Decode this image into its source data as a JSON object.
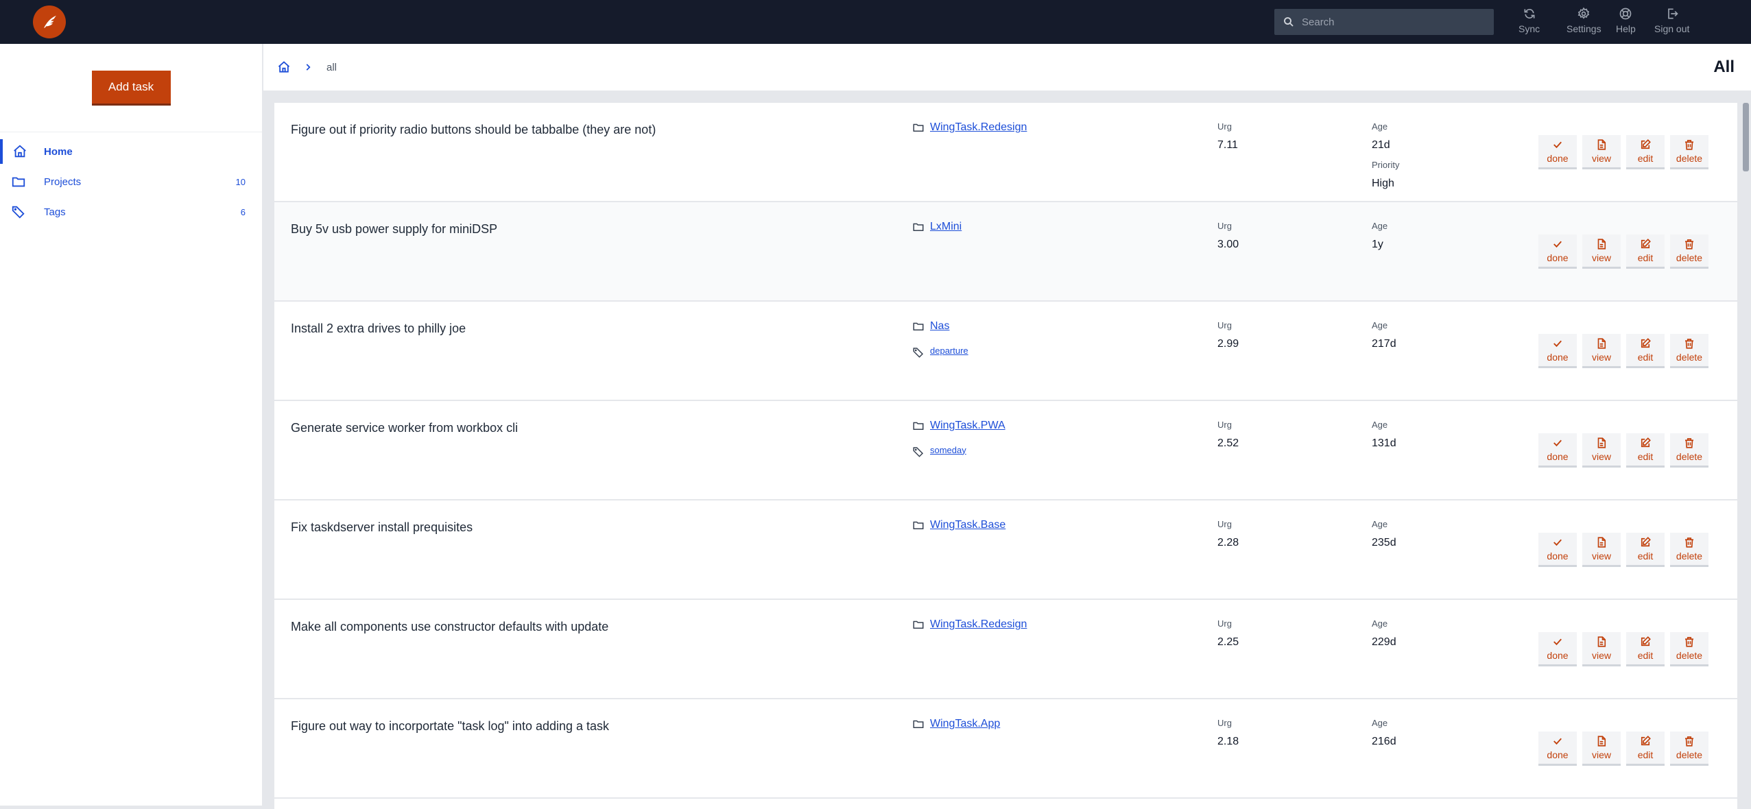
{
  "app": {
    "logo": "wing-logo",
    "accent": "#c2410c",
    "link_color": "#1d4ed8",
    "header_bg": "#151b2b"
  },
  "header": {
    "search_placeholder": "Search",
    "search_value": "",
    "nav": [
      {
        "label": "Sync",
        "icon": "sync-icon"
      },
      {
        "label": "Settings",
        "icon": "gear-icon"
      },
      {
        "label": "Help",
        "icon": "lifebuoy-icon"
      },
      {
        "label": "Sign out",
        "icon": "sign-out-icon"
      }
    ]
  },
  "sidebar": {
    "add_task_label": "Add task",
    "items": [
      {
        "label": "Home",
        "icon": "home-icon",
        "count": "",
        "active": true
      },
      {
        "label": "Projects",
        "icon": "folder-icon",
        "count": "10"
      },
      {
        "label": "Tags",
        "icon": "tag-icon",
        "count": "6"
      }
    ]
  },
  "breadcrumb": {
    "current": "all",
    "page_title": "All"
  },
  "labels": {
    "urg": "Urg",
    "age": "Age",
    "priority": "Priority",
    "done": "done",
    "view": "view",
    "edit": "edit",
    "delete": "delete"
  },
  "tasks": [
    {
      "description": "Figure out if priority radio buttons should be tabbalbe (they are not)",
      "project": "WingTask.Redesign",
      "tag": "",
      "urg": "7.11",
      "age": "21d",
      "priority": "High"
    },
    {
      "description": "Buy 5v usb power supply for miniDSP",
      "project": "LxMini",
      "tag": "",
      "urg": "3.00",
      "age": "1y",
      "priority": ""
    },
    {
      "description": "Install 2 extra drives to philly joe",
      "project": "Nas",
      "tag": "departure",
      "urg": "2.99",
      "age": "217d",
      "priority": ""
    },
    {
      "description": "Generate service worker from workbox cli",
      "project": "WingTask.PWA",
      "tag": "someday",
      "urg": "2.52",
      "age": "131d",
      "priority": ""
    },
    {
      "description": "Fix taskdserver install prequisites",
      "project": "WingTask.Base",
      "tag": "",
      "urg": "2.28",
      "age": "235d",
      "priority": ""
    },
    {
      "description": "Make all components use constructor defaults with update",
      "project": "WingTask.Redesign",
      "tag": "",
      "urg": "2.25",
      "age": "229d",
      "priority": ""
    },
    {
      "description": "Figure out way to incorportate \"task log\" into adding a task",
      "project": "WingTask.App",
      "tag": "",
      "urg": "2.18",
      "age": "216d",
      "priority": ""
    }
  ]
}
